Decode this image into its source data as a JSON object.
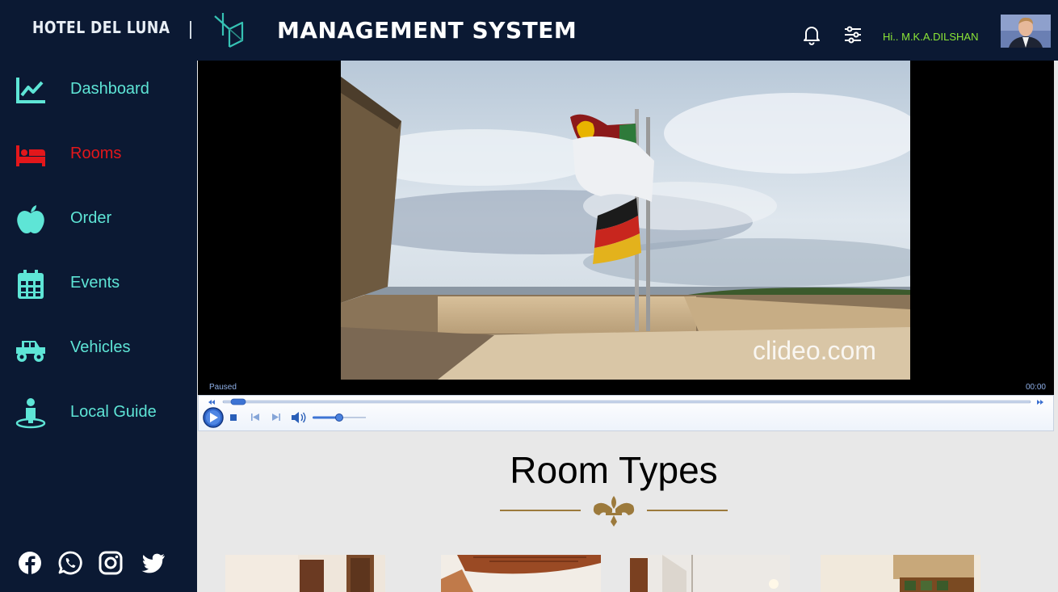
{
  "header": {
    "brand": "HOTEL DEL LUNA",
    "title": "MANAGEMENT SYSTEM",
    "greeting": "Hi.. M.K.A.DILSHAN",
    "icons": [
      "bell-icon",
      "sliders-icon"
    ]
  },
  "sidebar": {
    "items": [
      {
        "label": "Dashboard",
        "icon": "chart-line-icon",
        "active": false
      },
      {
        "label": "Rooms",
        "icon": "bed-icon",
        "active": true
      },
      {
        "label": "Order",
        "icon": "apple-icon",
        "active": false
      },
      {
        "label": "Events",
        "icon": "calendar-icon",
        "active": false
      },
      {
        "label": "Vehicles",
        "icon": "truck-icon",
        "active": false
      },
      {
        "label": "Local Guide",
        "icon": "guide-pin-icon",
        "active": false
      }
    ],
    "social": [
      "facebook-icon",
      "whatsapp-icon",
      "instagram-icon",
      "twitter-icon"
    ]
  },
  "player": {
    "status": "Paused",
    "time": "00:00",
    "watermark": "clideo.com",
    "volume_level": 0.5
  },
  "section": {
    "title": "Room Types"
  },
  "colors": {
    "navy": "#0b1933",
    "teal": "#5ee5d6",
    "active_red": "#e3171b",
    "greeting_green": "#8ce636",
    "gold": "#9c7a3c"
  }
}
